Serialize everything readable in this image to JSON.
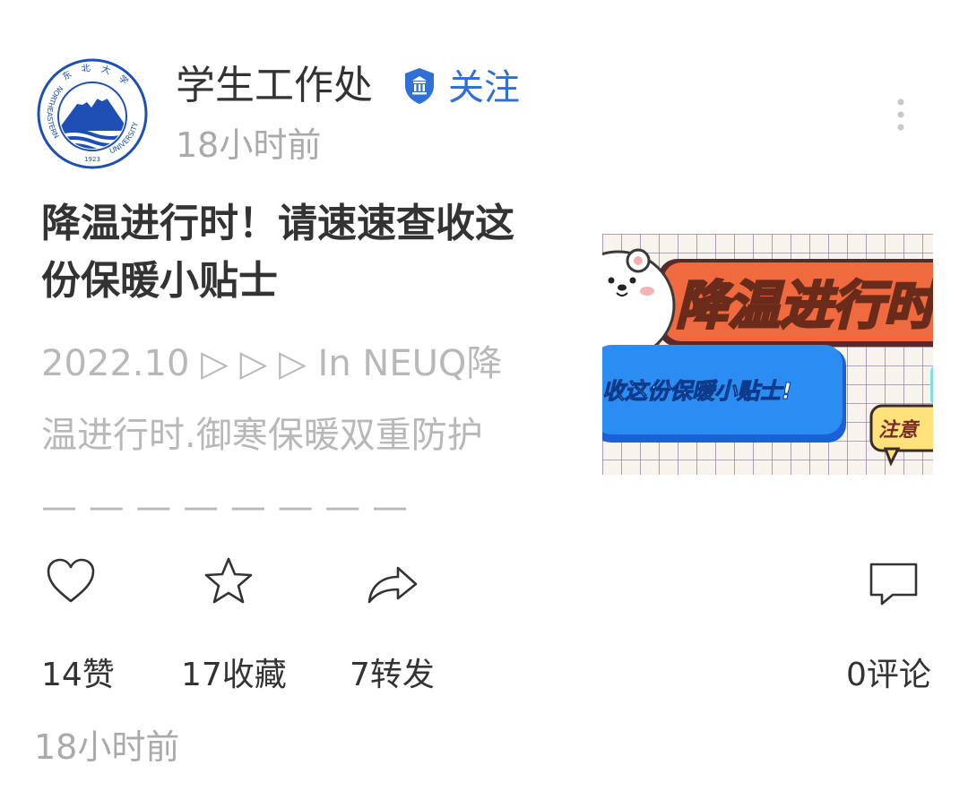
{
  "author": {
    "name": "学生工作处",
    "follow_label": "关注",
    "post_time": "18小时前",
    "verified_icon": "verified-badge-icon",
    "logo": {
      "top_text": "东 北 大 学",
      "ring_left": "NORTHEASTERN",
      "ring_right": "UNIVERSITY",
      "year": "1923"
    }
  },
  "article": {
    "title": "降温进行时！请速速查收这份保暖小贴士",
    "summary": "2022.10 ▷ ▷ ▷ In NEUQ降温进行时.御寒保暖双重防护 — — — — — — — — »»»»»...",
    "thumbnail": {
      "headline": "降温进行时",
      "subline": "收这份保暖小贴士!",
      "tag": "注意"
    }
  },
  "actions": {
    "like_count": "14赞",
    "favorite_count": "17收藏",
    "share_count": "7转发",
    "comment_count": "0评论"
  },
  "footer": {
    "time": "18小时前"
  },
  "colors": {
    "accent_blue": "#2f6fd6",
    "logo_blue": "#1e4fb5",
    "text_dark": "#333333",
    "text_gray": "#aaaaaa"
  }
}
